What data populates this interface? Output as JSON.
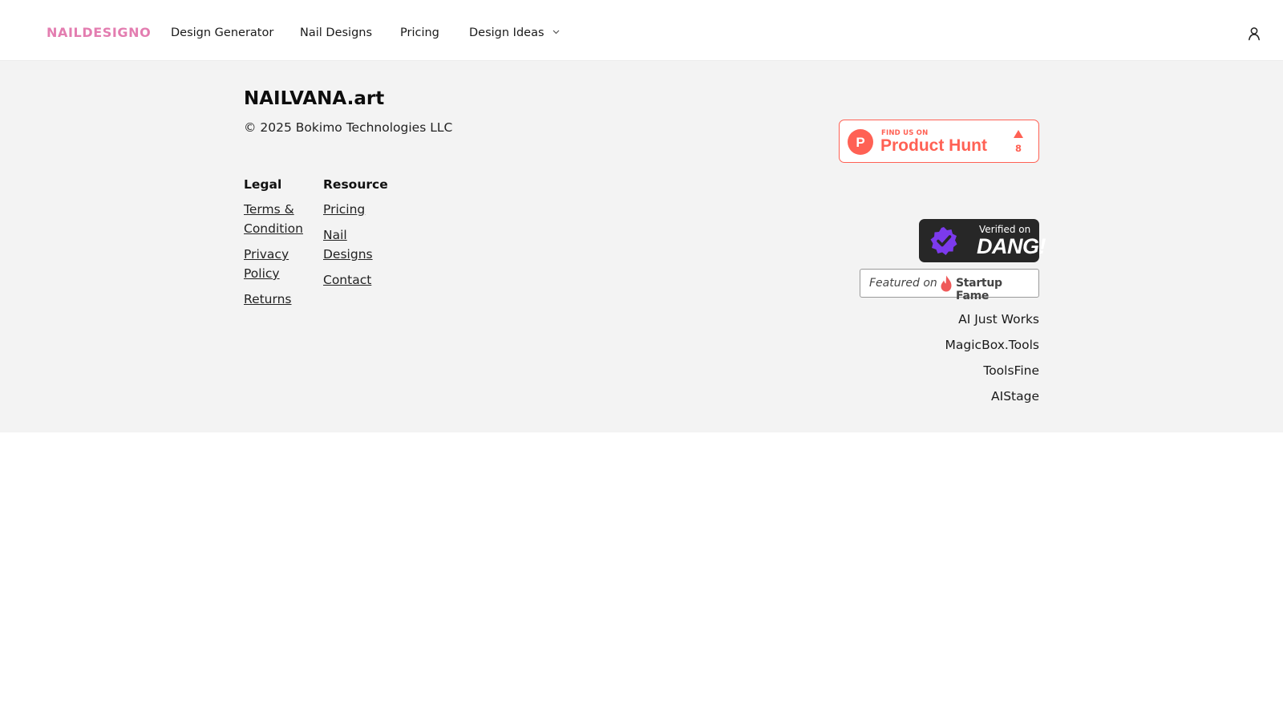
{
  "header": {
    "brand": "NAILDESIGNO",
    "nav": [
      {
        "label": "Design Generator"
      },
      {
        "label": "Nail Designs"
      },
      {
        "label": "Pricing"
      },
      {
        "label": "Design Ideas"
      }
    ],
    "user_icon": "user-icon",
    "dropdown_icon": "chevron-down-icon"
  },
  "footer": {
    "site_name": "NAILVANA.art",
    "copyright": "© 2025 Bokimo Technologies LLC",
    "legal": {
      "title": "Legal",
      "links": [
        "Terms & Condition",
        "Privacy Policy",
        "Returns"
      ]
    },
    "resource": {
      "title": "Resource",
      "links": [
        "Pricing",
        "Nail Designs",
        "Contact"
      ]
    },
    "badges": {
      "product_hunt": {
        "find_us": "FIND US ON",
        "name": "Product Hunt",
        "upvotes": "8",
        "letter": "P",
        "color": "#ff6154"
      },
      "dang": {
        "verified": "Verified on",
        "name": "DANG!",
        "seal_color": "#7c3aed"
      },
      "startup_fame": {
        "featured": "Featured on",
        "name": "Startup Fame",
        "flame_color": "#ef5a5a"
      }
    },
    "partners": [
      "AI Just Works",
      "MagicBox.Tools",
      "ToolsFine",
      "AIStage"
    ]
  },
  "colors": {
    "brand_pink": "#e37db0",
    "footer_bg": "#f3f3f3",
    "text": "#111111"
  }
}
